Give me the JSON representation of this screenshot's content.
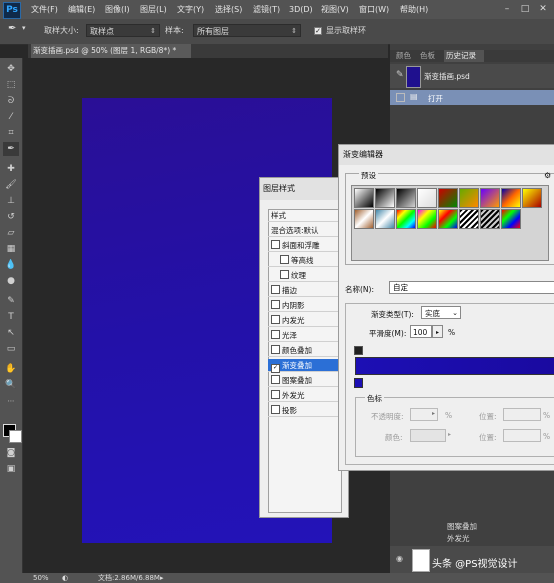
{
  "app": {
    "logo": "Ps"
  },
  "menu": [
    "文件(F)",
    "编辑(E)",
    "图像(I)",
    "图层(L)",
    "文字(Y)",
    "选择(S)",
    "滤镜(T)",
    "3D(D)",
    "视图(V)",
    "窗口(W)",
    "帮助(H)"
  ],
  "options": {
    "sample_size_label": "取样大小:",
    "sample_size_value": "取样点",
    "sample_label": "样本:",
    "sample_value": "所有图层",
    "show_ring_label": "显示取样环"
  },
  "doc_tab": {
    "title": "渐变插画.psd @ 50% (图层 1, RGB/8*) *"
  },
  "right_panel": {
    "tabs": [
      "颜色",
      "色板",
      "历史记录"
    ],
    "history_file": "渐变插画.psd",
    "history_open": "打开",
    "layer_effects": [
      "图案叠加",
      "外发光"
    ]
  },
  "layer_style": {
    "title": "图层样式",
    "header": "样式",
    "blend": "混合选项:默认",
    "items": [
      {
        "label": "斜面和浮雕",
        "checked": false
      },
      {
        "label": "等高线",
        "checked": false
      },
      {
        "label": "纹理",
        "checked": false
      },
      {
        "label": "描边",
        "checked": false
      },
      {
        "label": "内阴影",
        "checked": false
      },
      {
        "label": "内发光",
        "checked": false
      },
      {
        "label": "光泽",
        "checked": false
      },
      {
        "label": "颜色叠加",
        "checked": false
      },
      {
        "label": "渐变叠加",
        "checked": true
      },
      {
        "label": "图案叠加",
        "checked": false
      },
      {
        "label": "外发光",
        "checked": false
      },
      {
        "label": "投影",
        "checked": false
      }
    ]
  },
  "gradient_editor": {
    "title": "渐变编辑器",
    "presets_label": "预设",
    "name_label": "名称(N):",
    "name_value": "自定",
    "type_label": "渐变类型(T):",
    "type_value": "实底",
    "smooth_label": "平滑度(M):",
    "smooth_value": "100",
    "smooth_unit": "%",
    "stops_group": "色标",
    "opacity_label": "不透明度:",
    "opacity_unit": "%",
    "color_label": "颜色:",
    "location_label": "位置:",
    "location_unit": "%",
    "gradient_from": "#1c0fb4",
    "gradient_to": "#1a0aa0"
  },
  "status": {
    "zoom": "50%",
    "doc": "文档:2.86M/6.88M"
  },
  "watermark": {
    "text": "头条 @PS视觉设计"
  }
}
